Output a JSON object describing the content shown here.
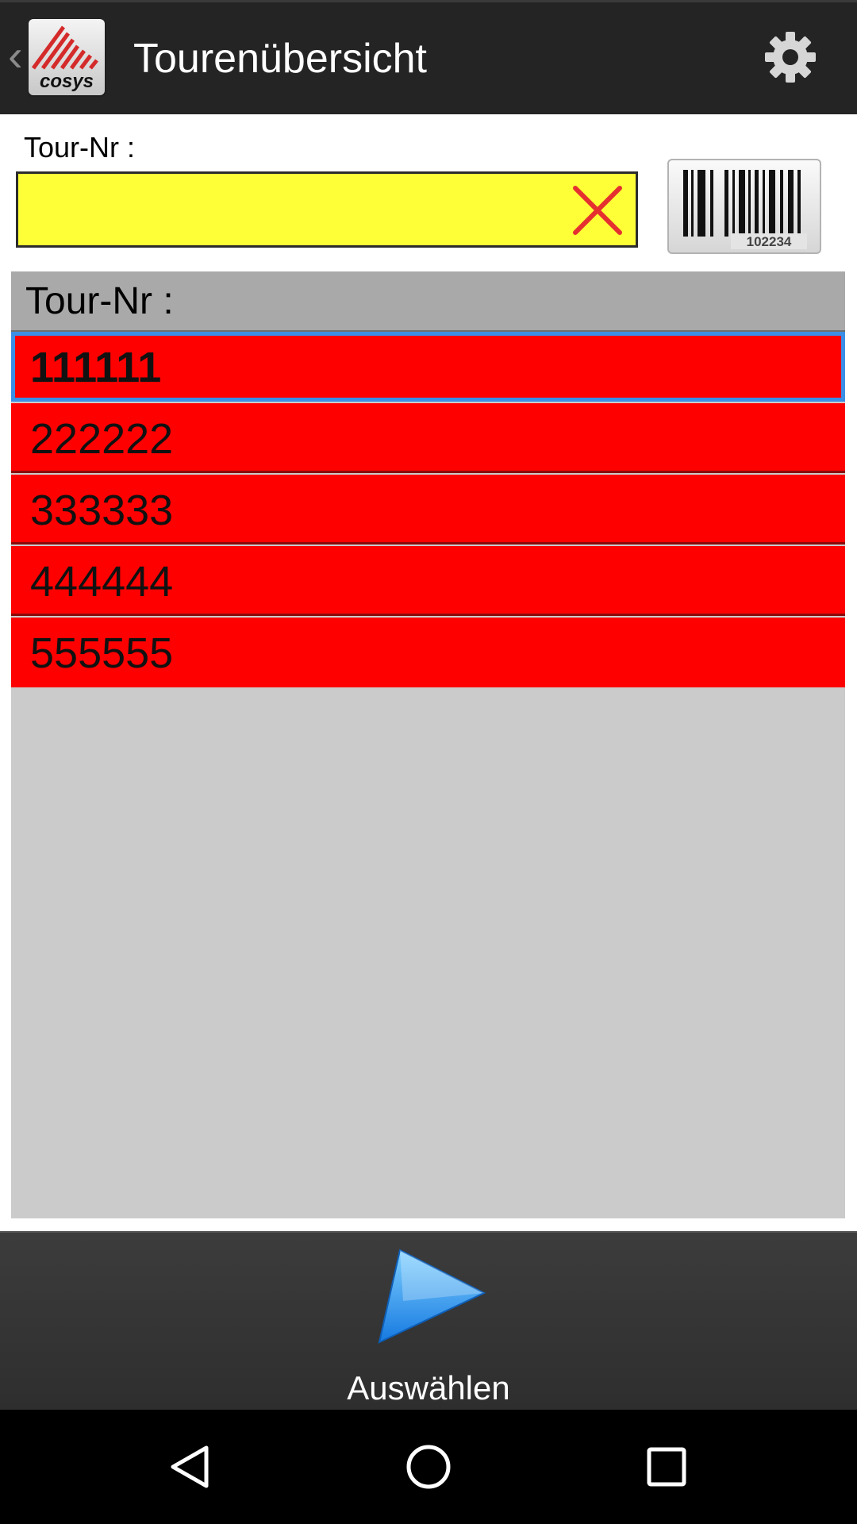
{
  "app": {
    "title": "Tourenübersicht",
    "logo_text": "cosys"
  },
  "form": {
    "tour_label": "Tour-Nr :",
    "tour_value": "",
    "barcode_number": "102234"
  },
  "list": {
    "header": "Tour-Nr :",
    "rows": [
      "111111",
      "222222",
      "333333",
      "444444",
      "555555"
    ],
    "selected_index": 0
  },
  "bottom": {
    "select_label": "Auswählen"
  },
  "colors": {
    "input_bg": "#ffff38",
    "row_bg": "#ff0000",
    "selection_border": "#3b8fe6",
    "clear_x": "#e53030"
  },
  "icons": {
    "back": "chevron-left-icon",
    "settings": "gear-icon",
    "clear": "close-icon",
    "barcode": "barcode-icon",
    "select": "play-icon"
  }
}
